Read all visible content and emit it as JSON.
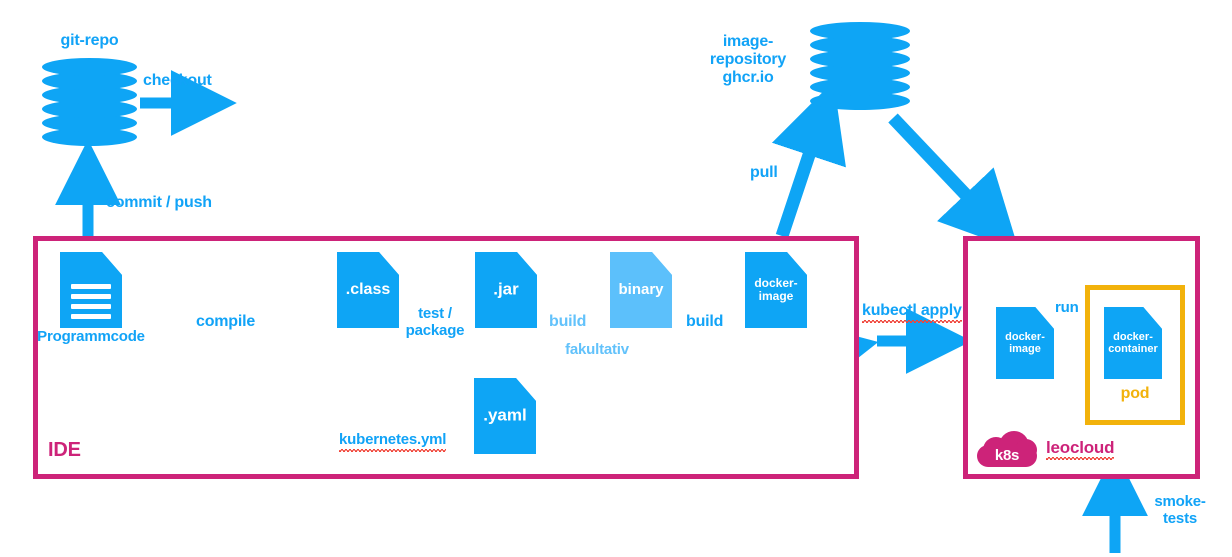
{
  "diagram": {
    "title": "CI/CD build and deployment pipeline",
    "colors": {
      "blue": "#0ea5f5",
      "light_blue": "#5cc0fb",
      "magenta": "#cd2379",
      "amber": "#f2b20b",
      "white": "#ffffff",
      "spellcheck_red": "#f0453a"
    }
  },
  "nodes": {
    "git_repo": {
      "label": "git-repo",
      "icon": "database-cylinder-icon"
    },
    "image_repository": {
      "label": "image-\nrepository\nghcr.io",
      "icon": "database-cylinder-icon"
    },
    "programmcode": {
      "icon_text": "",
      "label": "Programmcode",
      "icon": "document-lines-icon"
    },
    "class_file": {
      "icon_text": ".class",
      "icon": "file-icon"
    },
    "jar_file": {
      "icon_text": ".jar",
      "icon": "file-icon"
    },
    "binary_file": {
      "icon_text": "binary",
      "icon": "file-icon",
      "optional_note": "fakultativ"
    },
    "docker_image_ide": {
      "icon_text": "docker-\nimage",
      "icon": "file-icon"
    },
    "yaml_file": {
      "icon_text": ".yaml",
      "label": "kubernetes.yml",
      "icon": "file-icon"
    },
    "docker_image_cloud": {
      "icon_text": "docker-\nimage",
      "icon": "file-icon"
    },
    "docker_container": {
      "icon_text": "docker-\ncontainer",
      "icon": "file-icon"
    }
  },
  "containers": {
    "ide": {
      "label": "IDE"
    },
    "leocloud": {
      "label": "leocloud",
      "badge": "k8s",
      "badge_icon": "cloud-icon"
    },
    "pod": {
      "label": "pod"
    }
  },
  "edges": {
    "checkout": {
      "label": "checkout"
    },
    "commit_push": {
      "label": "commit / push"
    },
    "compile": {
      "label": "compile"
    },
    "test_package": {
      "label": "test /\npackage"
    },
    "build_binary": {
      "label": "build"
    },
    "build_image": {
      "label": "build"
    },
    "pull": {
      "label": "pull"
    },
    "kubectl_apply": {
      "label": "kubectl apply"
    },
    "run": {
      "label": "run"
    },
    "smoke_tests": {
      "label": "smoke-\ntests"
    },
    "deploy_down": {
      "label": ""
    },
    "yaml_to_cloud": {
      "label": ""
    }
  }
}
